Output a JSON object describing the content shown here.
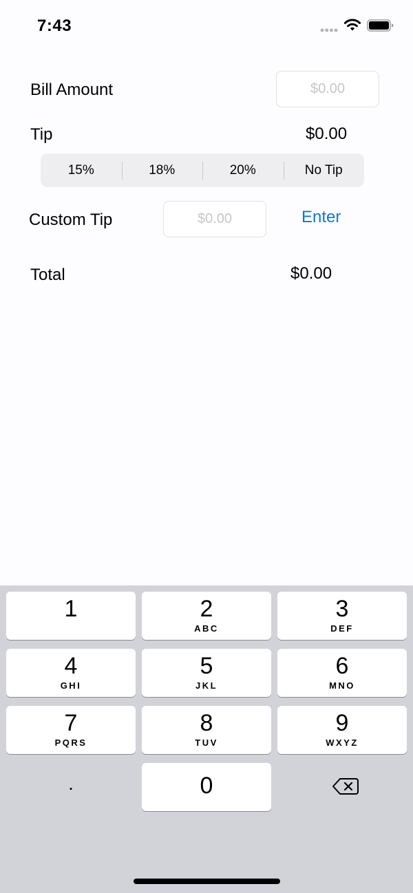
{
  "status_bar": {
    "time": "7:43"
  },
  "bill": {
    "label": "Bill Amount",
    "placeholder": "$0.00"
  },
  "tip": {
    "label": "Tip",
    "value": "$0.00",
    "options": [
      "15%",
      "18%",
      "20%",
      "No Tip"
    ]
  },
  "custom_tip": {
    "label": "Custom Tip",
    "placeholder": "$0.00",
    "enter_label": "Enter"
  },
  "total": {
    "label": "Total",
    "value": "$0.00"
  },
  "keyboard": {
    "keys": [
      {
        "digit": "1",
        "letters": ""
      },
      {
        "digit": "2",
        "letters": "ABC"
      },
      {
        "digit": "3",
        "letters": "DEF"
      },
      {
        "digit": "4",
        "letters": "GHI"
      },
      {
        "digit": "5",
        "letters": "JKL"
      },
      {
        "digit": "6",
        "letters": "MNO"
      },
      {
        "digit": "7",
        "letters": "PQRS"
      },
      {
        "digit": "8",
        "letters": "TUV"
      },
      {
        "digit": "9",
        "letters": "WXYZ"
      },
      {
        "digit": "0",
        "letters": ""
      }
    ],
    "decimal": ".",
    "backspace_icon": "backspace-icon"
  },
  "colors": {
    "accent": "#0a7ad8",
    "keyboard_background": "#d2d3d8",
    "segment_background": "#eeeef0",
    "placeholder": "#c6c6cb"
  }
}
